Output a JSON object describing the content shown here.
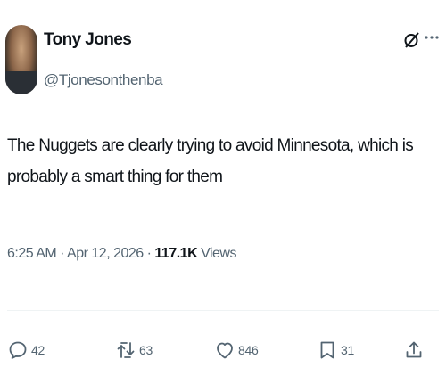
{
  "author": {
    "name": "Tony Jones",
    "handle": "@Tjonesonthenba"
  },
  "header_icons": {
    "grok": "grok-icon",
    "more": "more-dots-icon",
    "more_label": "···"
  },
  "tweet": {
    "text": "The Nuggets are clearly trying to avoid Minnesota, which is probably a smart thing for them",
    "time": "6:25 AM",
    "separator": "·",
    "date": "Apr 12, 2026",
    "views_count": "117.1K",
    "views_label": "Views"
  },
  "actions": {
    "reply": {
      "icon": "reply-icon",
      "count": "42"
    },
    "repost": {
      "icon": "repost-icon",
      "count": "63"
    },
    "like": {
      "icon": "heart-icon",
      "count": "846"
    },
    "bookmark": {
      "icon": "bookmark-icon",
      "count": "31"
    },
    "share": {
      "icon": "share-icon"
    }
  },
  "colors": {
    "text_primary": "#0f1419",
    "text_secondary": "#536471",
    "divider": "#eff3f4"
  }
}
